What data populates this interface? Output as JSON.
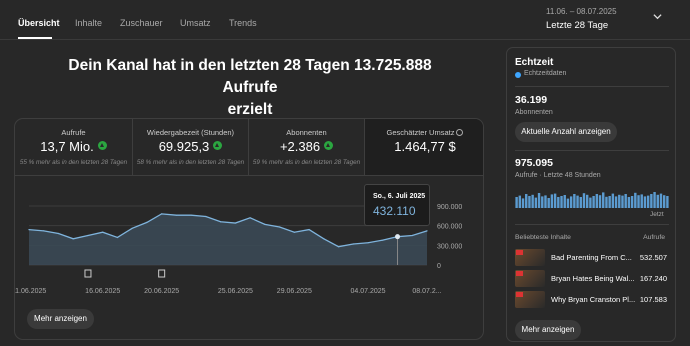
{
  "tabs": [
    "Übersicht",
    "Inhalte",
    "Zuschauer",
    "Umsatz",
    "Trends"
  ],
  "range": {
    "dates": "11.06. – 08.07.2025",
    "label": "Letzte 28 Tage"
  },
  "headline": {
    "line1": "Dein Kanal hat in den letzten 28 Tagen 13.725.888 Aufrufe",
    "line2": "erzielt"
  },
  "metrics": [
    {
      "label": "Aufrufe",
      "value": "13,7 Mio.",
      "sub": "55 % mehr als in den letzten 28 Tagen"
    },
    {
      "label": "Wiedergabezeit (Stunden)",
      "value": "69.925,3",
      "sub": "58 % mehr als in den letzten 28 Tagen"
    },
    {
      "label": "Abonnenten",
      "value": "+2.386",
      "sub": "59 % mehr als in den letzten 28 Tagen"
    },
    {
      "label": "Geschätzter Umsatz",
      "value": "1.464,77 $"
    }
  ],
  "chart_data": {
    "type": "area",
    "x": [
      "11.06.2025",
      "12.06.2025",
      "13.06.2025",
      "14.06.2025",
      "15.06.2025",
      "16.06.2025",
      "17.06.2025",
      "18.06.2025",
      "19.06.2025",
      "20.06.2025",
      "21.06.2025",
      "22.06.2025",
      "23.06.2025",
      "24.06.2025",
      "25.06.2025",
      "26.06.2025",
      "27.06.2025",
      "28.06.2025",
      "29.06.2025",
      "30.06.2025",
      "01.07.2025",
      "02.07.2025",
      "03.07.2025",
      "04.07.2025",
      "05.07.2025",
      "06.07.2025",
      "07.07.2025",
      "08.07.2025"
    ],
    "values": [
      540000,
      520000,
      480000,
      400000,
      450000,
      500000,
      420000,
      560000,
      650000,
      780000,
      760000,
      760000,
      740000,
      660000,
      640000,
      720000,
      620000,
      580000,
      500000,
      540000,
      400000,
      280000,
      320000,
      340000,
      380000,
      432110,
      450000,
      520000
    ],
    "tick_labels": [
      "11.06.2025",
      "16.06.2025",
      "20.06.2025",
      "25.06.2025",
      "29.06.2025",
      "04.07.2025",
      "08.07.2..."
    ],
    "ytick_labels": [
      "900.000",
      "600.000",
      "300.000",
      "0"
    ],
    "ylim": [
      0,
      900000
    ],
    "tooltip": {
      "date": "So., 6. Juli 2025",
      "value": "432.110"
    },
    "color": "#7fb4dd",
    "grid": true
  },
  "buttons": {
    "more_main": "Mehr anzeigen",
    "more_side": "Mehr anzeigen",
    "live_count": "Aktuelle Anzahl anzeigen"
  },
  "realtime": {
    "title": "Echtzeit",
    "live": "Echtzeitdaten",
    "subs_value": "36.199",
    "subs_label": "Abonnenten",
    "views_value": "975.095",
    "views_label": "Aufrufe · Letzte 48 Stunden",
    "now": "Jetzt",
    "bars": [
      0.55,
      0.62,
      0.48,
      0.7,
      0.6,
      0.66,
      0.52,
      0.75,
      0.58,
      0.63,
      0.5,
      0.68,
      0.72,
      0.55,
      0.6,
      0.65,
      0.47,
      0.58,
      0.7,
      0.62,
      0.55,
      0.74,
      0.66,
      0.52,
      0.6,
      0.7,
      0.64,
      0.78,
      0.56,
      0.6,
      0.72,
      0.58,
      0.66,
      0.62,
      0.7,
      0.55,
      0.6,
      0.76,
      0.64,
      0.68,
      0.58,
      0.62,
      0.7,
      0.8,
      0.66,
      0.72,
      0.64,
      0.6
    ],
    "popular_head": "Beliebteste Inhalte",
    "popular_val_head": "Aufrufe",
    "popular": [
      {
        "title": "Bad Parenting From C...",
        "views": "532.507"
      },
      {
        "title": "Bryan Hates Being Wal...",
        "views": "167.240"
      },
      {
        "title": "Why Bryan Cranston Pl...",
        "views": "107.583"
      }
    ]
  }
}
